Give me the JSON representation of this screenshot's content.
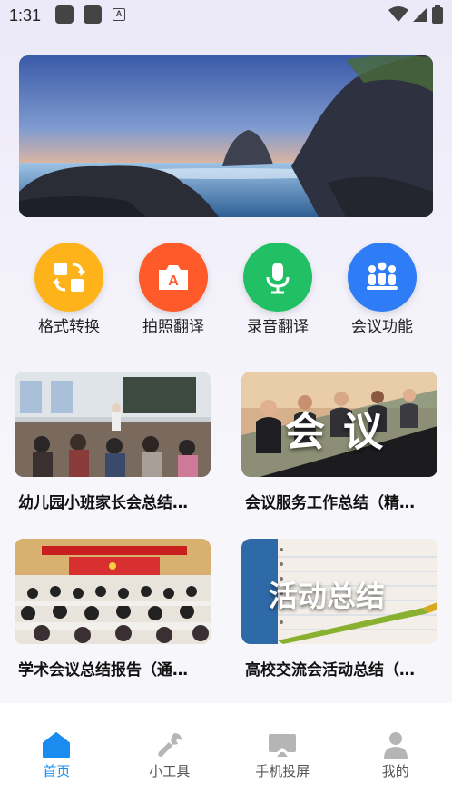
{
  "status_bar": {
    "time": "1:31",
    "badge_letter": "A"
  },
  "features": [
    {
      "label": "格式转换",
      "color": "#ffb31a",
      "icon": "convert-icon"
    },
    {
      "label": "拍照翻译",
      "color": "#ff5a2a",
      "icon": "camera-translate-icon"
    },
    {
      "label": "录音翻译",
      "color": "#22c065",
      "icon": "microphone-icon"
    },
    {
      "label": "会议功能",
      "color": "#2e7cf6",
      "icon": "meeting-icon"
    }
  ],
  "cards": [
    {
      "title": "幼儿园小班家长会总结…",
      "overlay": ""
    },
    {
      "title": "会议服务工作总结（精…",
      "overlay": "会议"
    },
    {
      "title": "学术会议总结报告（通…",
      "overlay": ""
    },
    {
      "title": "高校交流会活动总结（…",
      "overlay": "活动总结"
    }
  ],
  "bottom_nav": [
    {
      "label": "首页",
      "icon": "home-icon",
      "active": true
    },
    {
      "label": "小工具",
      "icon": "wrench-icon",
      "active": false
    },
    {
      "label": "手机投屏",
      "icon": "screen-cast-icon",
      "active": false
    },
    {
      "label": "我的",
      "icon": "user-icon",
      "active": false
    }
  ],
  "colors": {
    "accent": "#1a8cf0",
    "inactive_icon": "#b5b5b5"
  }
}
